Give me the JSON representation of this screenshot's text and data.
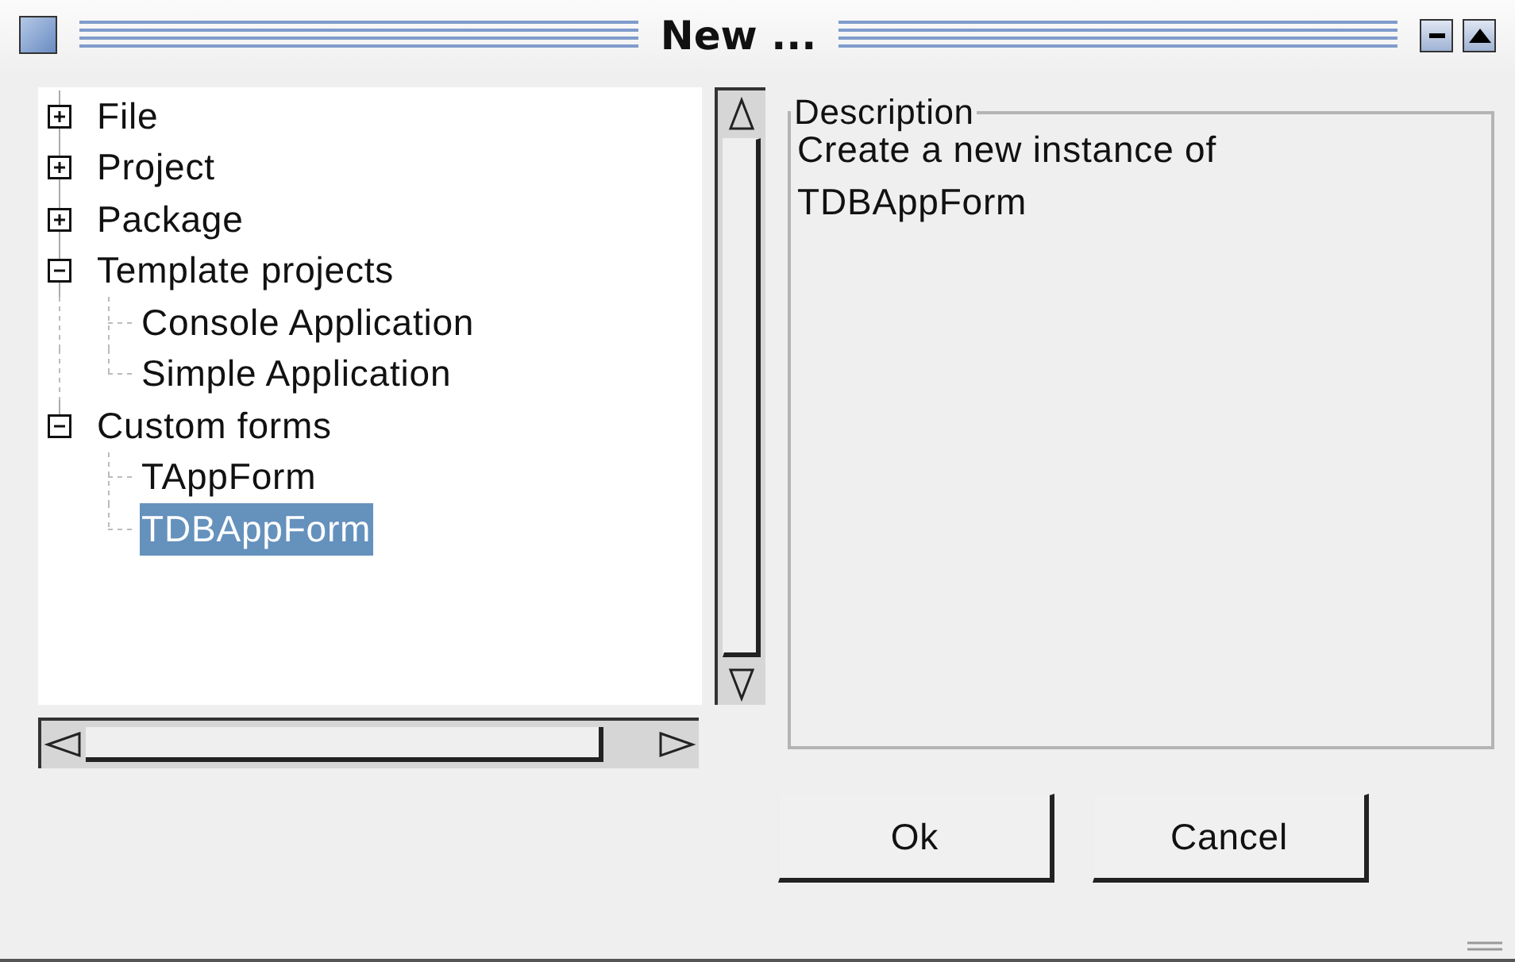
{
  "window": {
    "title": "New ..."
  },
  "tree": {
    "items": [
      {
        "label": "File",
        "expanded": false,
        "selected": false
      },
      {
        "label": "Project",
        "expanded": false,
        "selected": false
      },
      {
        "label": "Package",
        "expanded": false,
        "selected": false
      },
      {
        "label": "Template projects",
        "expanded": true,
        "selected": false,
        "children": [
          {
            "label": "Console Application",
            "selected": false
          },
          {
            "label": "Simple Application",
            "selected": false
          }
        ]
      },
      {
        "label": "Custom forms",
        "expanded": true,
        "selected": false,
        "children": [
          {
            "label": "TAppForm",
            "selected": false
          },
          {
            "label": "TDBAppForm",
            "selected": true
          }
        ]
      }
    ]
  },
  "description": {
    "legend": "Description",
    "text": "Create a new instance of TDBAppForm"
  },
  "buttons": [
    {
      "label": "Ok"
    },
    {
      "label": "Cancel"
    }
  ]
}
